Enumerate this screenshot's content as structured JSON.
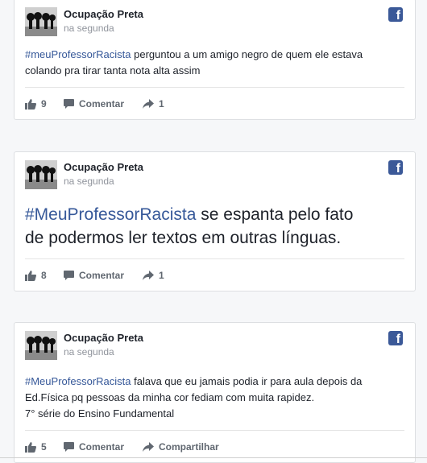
{
  "posts": [
    {
      "author": "Ocupação Preta",
      "time": "na segunda",
      "hashtag": "#meuProfessorRacista",
      "text_line1": " perguntou a um amigo negro de quem ele estava",
      "text_line2": "colando pra tirar tanta nota alta assim",
      "text_line3": "",
      "likes": "9",
      "comment_label": "Comentar",
      "third_action": "1"
    },
    {
      "author": "Ocupação Preta",
      "time": "na segunda",
      "hashtag": "#MeuProfessorRacista",
      "text_line1": " se espanta pelo fato",
      "text_line2": "de podermos ler textos em outras línguas.",
      "text_line3": "",
      "likes": "8",
      "comment_label": "Comentar",
      "third_action": "1"
    },
    {
      "author": "Ocupação Preta",
      "time": "na segunda",
      "hashtag": "#MeuProfessorRacista",
      "text_line1": " falava que eu jamais podia ir para aula depois da",
      "text_line2": "Ed.Física pq pessoas da minha cor fediam com muita rapidez.",
      "text_line3": "7° série do Ensino Fundamental",
      "likes": "5",
      "comment_label": "Comentar",
      "third_action": "Compartilhar"
    }
  ],
  "colors": {
    "link": "#365899",
    "facebook": "#3b5998",
    "muted": "#90949c"
  }
}
